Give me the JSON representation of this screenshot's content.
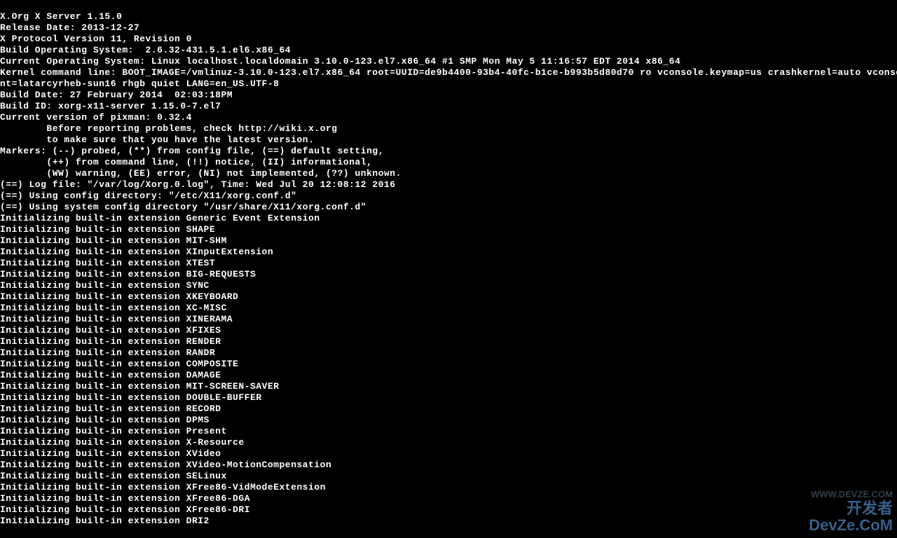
{
  "console": {
    "lines": [
      "X.Org X Server 1.15.0",
      "Release Date: 2013-12-27",
      "X Protocol Version 11, Revision 0",
      "Build Operating System:  2.6.32-431.5.1.el6.x86_64",
      "Current Operating System: Linux localhost.localdomain 3.10.0-123.el7.x86_64 #1 SMP Mon May 5 11:16:57 EDT 2014 x86_64",
      "Kernel command line: BOOT_IMAGE=/vmlinuz-3.10.0-123.el7.x86_64 root=UUID=de9b4400-93b4-40fc-b1ce-b993b5d80d70 ro vconsole.keymap=us crashkernel=auto vconsole.fo",
      "nt=latarcyrheb-sun16 rhgb quiet LANG=en_US.UTF-8",
      "Build Date: 27 February 2014  02:03:18PM",
      "Build ID: xorg-x11-server 1.15.0-7.el7",
      "Current version of pixman: 0.32.4",
      "        Before reporting problems, check http://wiki.x.org",
      "        to make sure that you have the latest version.",
      "Markers: (--) probed, (**) from config file, (==) default setting,",
      "        (++) from command line, (!!) notice, (II) informational,",
      "        (WW) warning, (EE) error, (NI) not implemented, (??) unknown.",
      "(==) Log file: \"/var/log/Xorg.0.log\", Time: Wed Jul 20 12:08:12 2016",
      "(==) Using config directory: \"/etc/X11/xorg.conf.d\"",
      "(==) Using system config directory \"/usr/share/X11/xorg.conf.d\"",
      "Initializing built-in extension Generic Event Extension",
      "Initializing built-in extension SHAPE",
      "Initializing built-in extension MIT-SHM",
      "Initializing built-in extension XInputExtension",
      "Initializing built-in extension XTEST",
      "Initializing built-in extension BIG-REQUESTS",
      "Initializing built-in extension SYNC",
      "Initializing built-in extension XKEYBOARD",
      "Initializing built-in extension XC-MISC",
      "Initializing built-in extension XINERAMA",
      "Initializing built-in extension XFIXES",
      "Initializing built-in extension RENDER",
      "Initializing built-in extension RANDR",
      "Initializing built-in extension COMPOSITE",
      "Initializing built-in extension DAMAGE",
      "Initializing built-in extension MIT-SCREEN-SAVER",
      "Initializing built-in extension DOUBLE-BUFFER",
      "Initializing built-in extension RECORD",
      "Initializing built-in extension DPMS",
      "Initializing built-in extension Present",
      "Initializing built-in extension X-Resource",
      "Initializing built-in extension XVideo",
      "Initializing built-in extension XVideo-MotionCompensation",
      "Initializing built-in extension SELinux",
      "Initializing built-in extension XFree86-VidModeExtension",
      "Initializing built-in extension XFree86-DGA",
      "Initializing built-in extension XFree86-DRI",
      "Initializing built-in extension DRI2"
    ]
  },
  "watermark": {
    "line1": "WWW.DEVZE.COM",
    "line2": "开发者",
    "line3": "DevZe.CoM"
  }
}
